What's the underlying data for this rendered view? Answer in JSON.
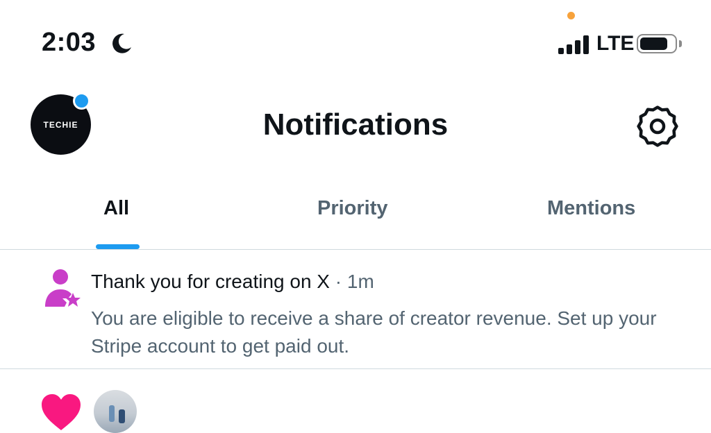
{
  "status_bar": {
    "time": "2:03",
    "network": "LTE",
    "icons": [
      "moon-icon",
      "signal-icon",
      "battery-icon"
    ]
  },
  "header": {
    "avatar_text": "TECHIE",
    "title": "Notifications",
    "settings_icon": "gear-icon"
  },
  "tabs": [
    {
      "label": "All",
      "active": true
    },
    {
      "label": "Priority",
      "active": false
    },
    {
      "label": "Mentions",
      "active": false
    }
  ],
  "notifications": [
    {
      "icon": "person-star-icon",
      "title": "Thank you for creating on X",
      "separator": "·",
      "time": "1m",
      "body": "You are eligible to receive a share of creator revenue. Set up your Stripe account to get paid out."
    },
    {
      "icon": "heart-icon"
    }
  ],
  "colors": {
    "accent": "#1d9bf0",
    "text_primary": "#0f1419",
    "text_secondary": "#536471",
    "creator_icon": "#c93ec8",
    "like": "#f91880",
    "status_dot": "#f7a23b"
  }
}
